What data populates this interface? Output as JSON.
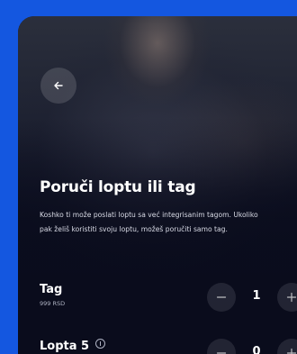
{
  "header": {
    "back_icon": "arrow-left-icon"
  },
  "main": {
    "title": "Poruči loptu ili tag",
    "description": "Koshko ti može poslati loptu sa već integrisanim tagom. Ukoliko pak želiš koristiti svoju loptu, možeš poručiti samo tag."
  },
  "items": [
    {
      "name": "Tag",
      "price": "999 RSD",
      "quantity": "1"
    },
    {
      "name": "Lopta 5",
      "info_icon": "info-icon",
      "quantity": "0"
    }
  ],
  "colors": {
    "frame_background": "#1457e0",
    "screen_background": "#0b0e1d",
    "text_primary": "#ffffff",
    "text_secondary": "#aeb2c2"
  }
}
